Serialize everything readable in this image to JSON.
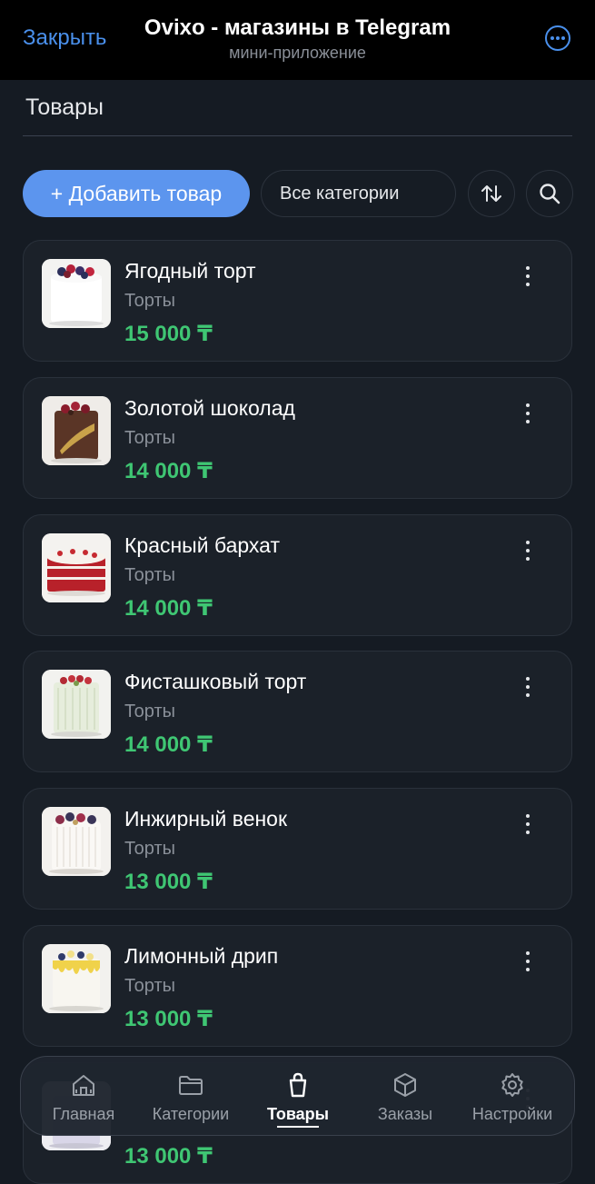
{
  "header": {
    "close_label": "Закрыть",
    "title": "Ovixo - магазины в Telegram",
    "subtitle": "мини-приложение",
    "more_icon": "more-circle-icon"
  },
  "page": {
    "title": "Товары"
  },
  "toolbar": {
    "add_label": "+ Добавить товар",
    "category_value": "Все категории",
    "sort_icon": "sort-arrows-icon",
    "search_icon": "search-icon"
  },
  "products": [
    {
      "name": "Ягодный торт",
      "category": "Торты",
      "price": "15 000 ₸"
    },
    {
      "name": "Золотой шоколад",
      "category": "Торты",
      "price": "14 000 ₸"
    },
    {
      "name": "Красный бархат",
      "category": "Торты",
      "price": "14 000 ₸"
    },
    {
      "name": "Фисташковый торт",
      "category": "Торты",
      "price": "14 000 ₸"
    },
    {
      "name": "Инжирный венок",
      "category": "Торты",
      "price": "13 000 ₸"
    },
    {
      "name": "Лимонный дрип",
      "category": "Торты",
      "price": "13 000 ₸"
    },
    {
      "name": "",
      "category": "",
      "price": "13 000 ₸"
    }
  ],
  "nav": [
    {
      "label": "Главная",
      "icon": "home-icon"
    },
    {
      "label": "Категории",
      "icon": "folder-icon"
    },
    {
      "label": "Товары",
      "icon": "bag-icon",
      "active": true
    },
    {
      "label": "Заказы",
      "icon": "box-icon"
    },
    {
      "label": "Настройки",
      "icon": "gear-icon"
    }
  ],
  "colors": {
    "accent": "#5c95ee",
    "price": "#3fc673",
    "background": "#151b23",
    "card": "#1b2129",
    "telegram_blue": "#4a90ec"
  }
}
